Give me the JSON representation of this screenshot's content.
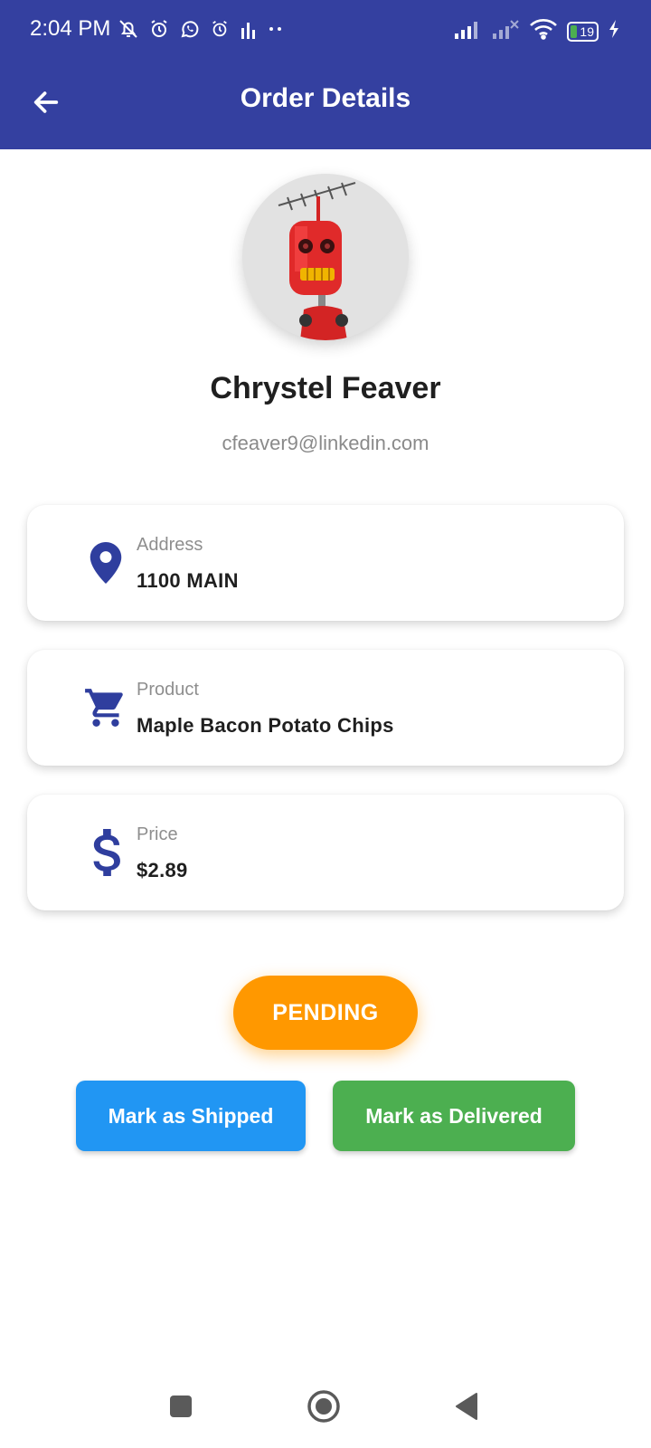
{
  "status_bar": {
    "time": "2:04 PM",
    "battery": "19",
    "icons_left": [
      "mute-icon",
      "alarm-icon",
      "whatsapp-icon",
      "alarm-icon",
      "signal-bars-icon",
      "more-dots-icon"
    ],
    "icons_right": [
      "cell-signal-icon",
      "cell-signal-off-icon",
      "wifi-icon",
      "battery-icon",
      "charging-icon"
    ]
  },
  "app_bar": {
    "title": "Order Details"
  },
  "customer": {
    "name": "Chrystel Feaver",
    "email": "cfeaver9@linkedin.com"
  },
  "details": {
    "address": {
      "label": "Address",
      "value": "1100 MAIN",
      "icon": "location-pin-icon"
    },
    "product": {
      "label": "Product",
      "value": "Maple Bacon Potato Chips",
      "icon": "cart-icon"
    },
    "price": {
      "label": "Price",
      "value": "$2.89",
      "icon": "dollar-icon"
    }
  },
  "order_status": {
    "label": "PENDING",
    "color": "#FF9800"
  },
  "actions": {
    "shipped_label": "Mark as Shipped",
    "delivered_label": "Mark as Delivered"
  },
  "colors": {
    "primary": "#3440A0",
    "icon": "#2F3E9E",
    "shipped": "#2196F3",
    "delivered": "#4CAF50",
    "pending": "#FF9800"
  }
}
